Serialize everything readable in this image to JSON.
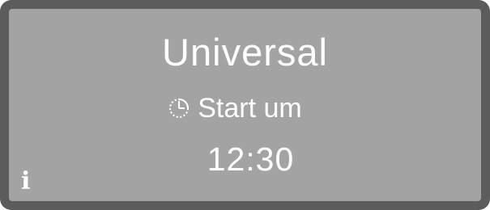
{
  "display": {
    "program_name": "Universal",
    "start_label": "Start um",
    "start_time": "12:30",
    "info_symbol": "i"
  },
  "icons": {
    "clock": "timer-clock-icon",
    "info": "info-icon"
  },
  "colors": {
    "bezel": "#5c5c5c",
    "screen_background": "#a3a3a3",
    "text": "#ffffff"
  }
}
